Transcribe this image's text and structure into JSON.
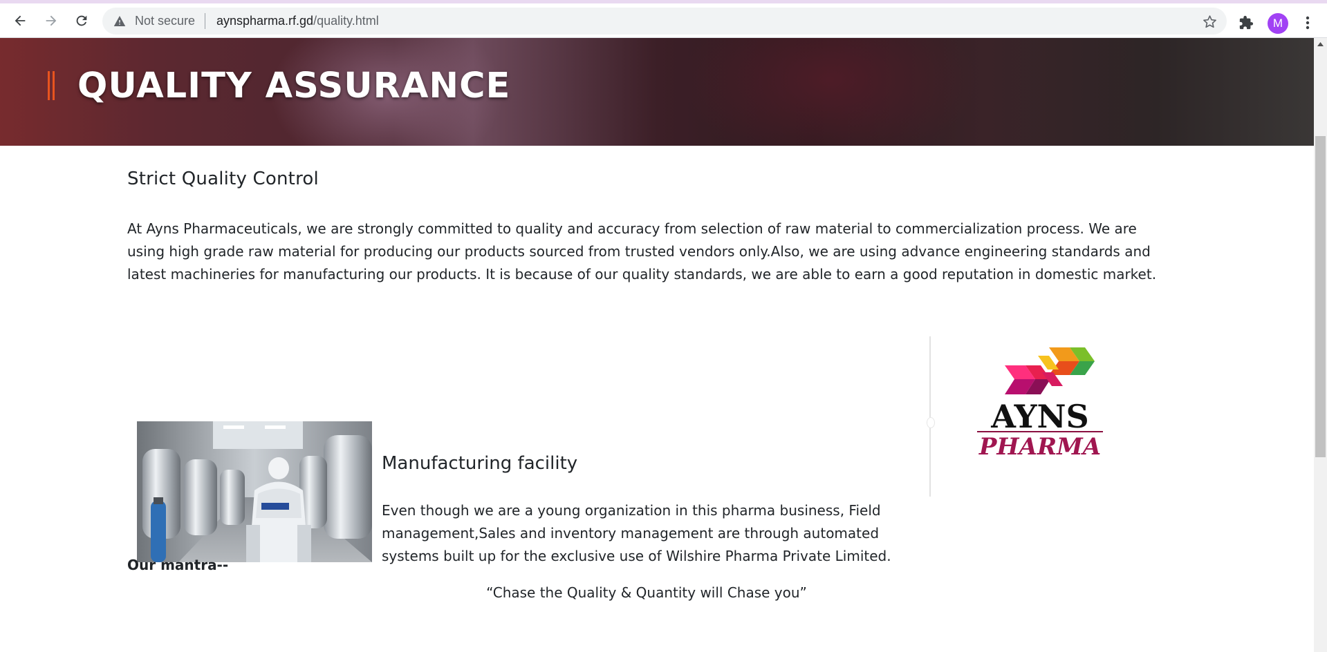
{
  "browser": {
    "security_label": "Not secure",
    "url_host": "aynspharma.rf.gd",
    "url_path": "/quality.html",
    "avatar_initial": "M",
    "accent_color": "#a142f4"
  },
  "banner": {
    "title": "QUALITY ASSURANCE",
    "accent_color": "#e8541f"
  },
  "section": {
    "heading": "Strict Quality Control",
    "paragraph": "At Ayns Pharmaceuticals, we are strongly committed to quality and accuracy from selection of raw material to commercialization process. We are using high grade raw material for producing our products sourced from trusted vendors only.Also, we are using advance engineering standards and latest machineries for manufacturing our products. It is because of our quality standards, we are able to earn a good reputation in domestic market."
  },
  "manufacturing": {
    "heading": "Manufacturing facility",
    "paragraph": "Even though we are a young organization in this pharma business, Field management,Sales and inventory management are through automated systems built up for the exclusive use of Wilshire Pharma Private Limited."
  },
  "logo": {
    "line1": "AYNS",
    "line2": "PHARMA"
  },
  "mantra": {
    "label": "Our mantra--",
    "quote": "“Chase the Quality & Quantity will Chase you”"
  }
}
